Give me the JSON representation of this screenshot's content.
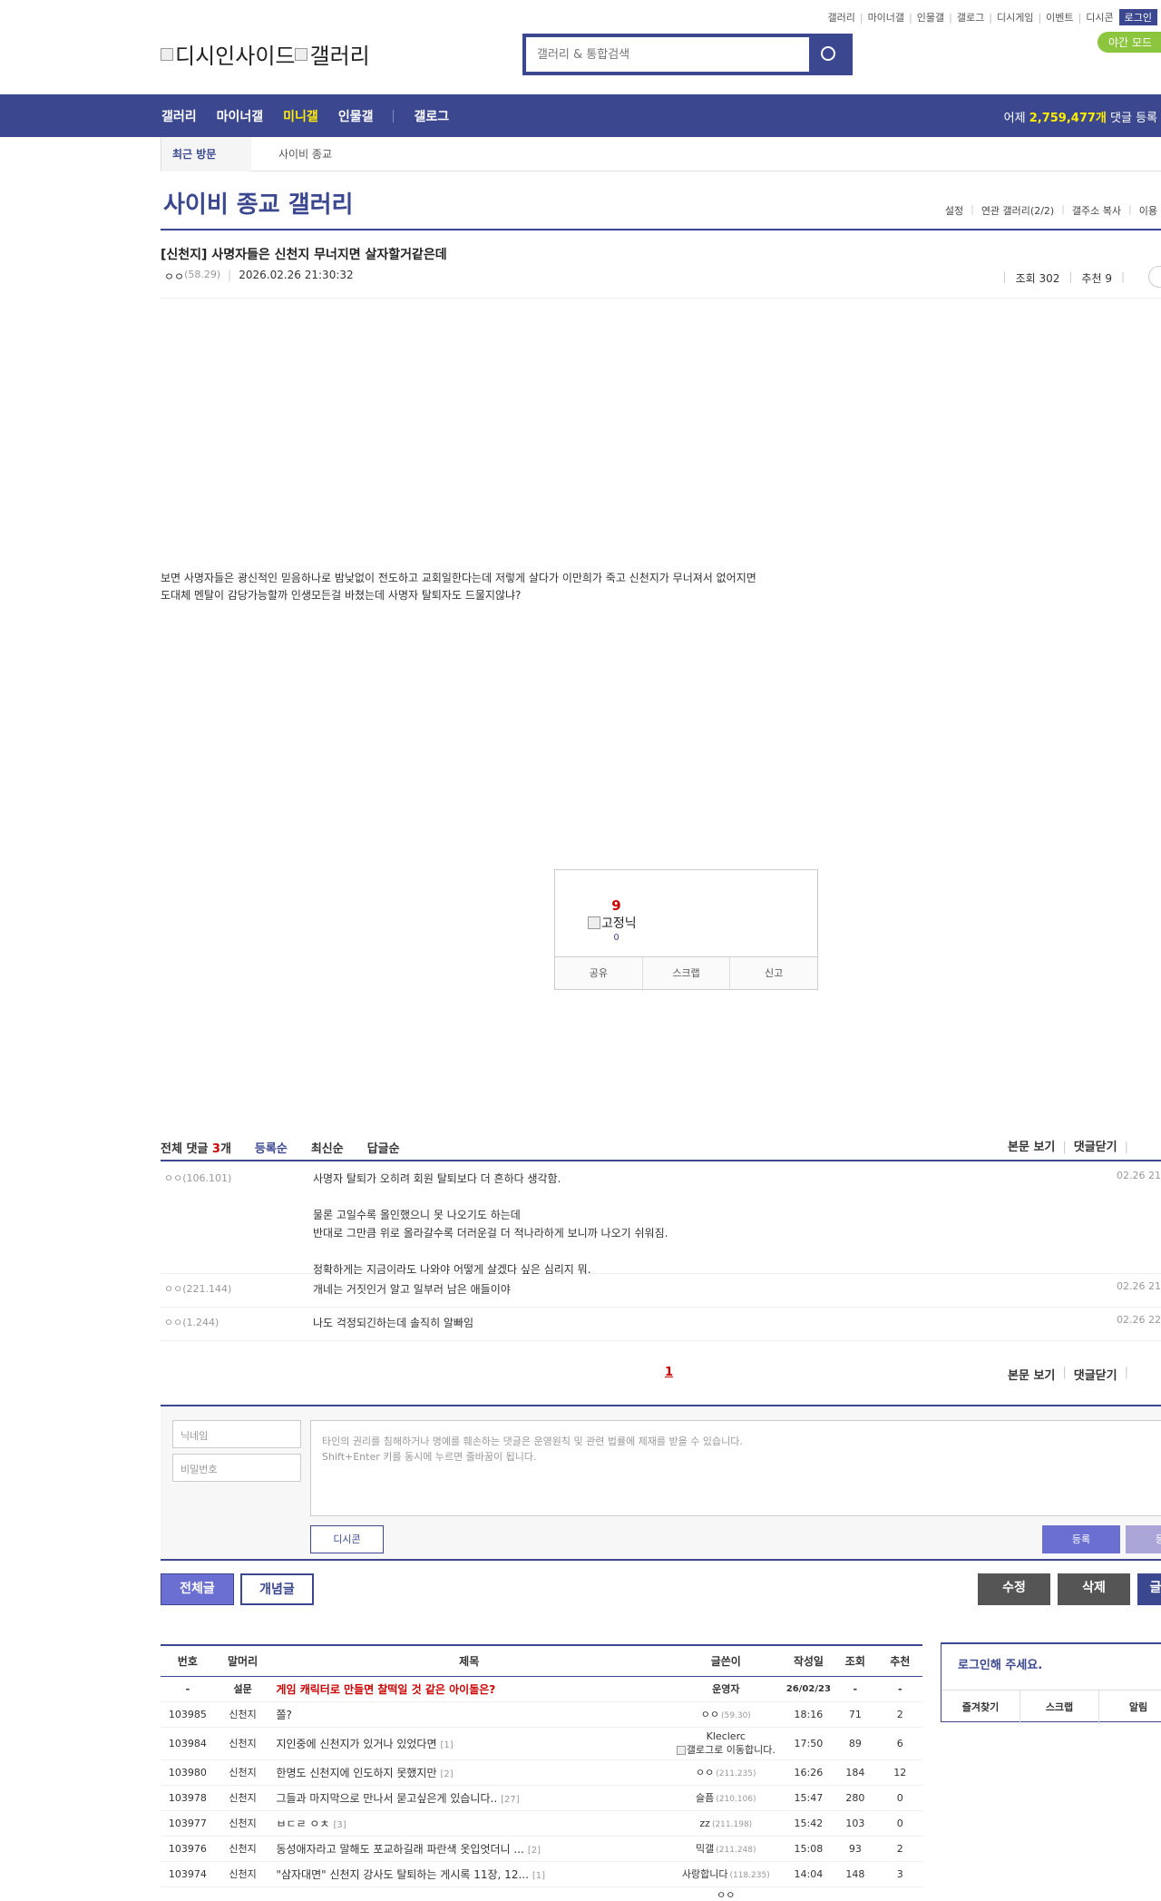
{
  "util": {
    "links": [
      "갤러리",
      "마이너갤",
      "인물갤",
      "갤로그",
      "디시게임",
      "이벤트",
      "디시콘"
    ],
    "login": "로그인",
    "night": "야간 모드"
  },
  "logo": {
    "brand": "디시인사이드",
    "sub": "갤러리"
  },
  "search": {
    "placeholder": "갤러리 & 통합검색"
  },
  "gnb": {
    "items": [
      "갤러리",
      "마이너갤",
      "미니갤",
      "인물갤",
      "갤로그"
    ],
    "stat_prefix": "어제 ",
    "stat_value": "2,759,477개",
    "stat_suffix": " 댓글 등록"
  },
  "recent": {
    "label": "최근 방문",
    "item": "사이비 종교"
  },
  "gallery": {
    "title": "사이비 종교 갤러리",
    "menu": [
      "설정",
      "연관 갤러리(2/2)",
      "갤주소 복사",
      "이용"
    ]
  },
  "post": {
    "title": "[신천지] 사명자들은 신천지 무너지면 살자할거같은데",
    "author": "ㅇㅇ",
    "ip": "(58.29)",
    "date": "2026.02.26 21:30:32",
    "views": "조회 302",
    "recommend": "추천 9",
    "body_line1": "보면 사명자들은 광신적인 믿음하나로 밤낮없이 전도하고 교회일한다는데 저렇게 살다가 이만희가 죽고 신천지가 무너져서 없어지면",
    "body_line2": "도대체 멘탈이 감당가능할까 인생모든걸 바쳤는데 사명자 탈퇴자도 드물지않냐?"
  },
  "recommend_box": {
    "count": "9",
    "fixed_label": "고정닉",
    "fixed_count": "0",
    "share": "공유",
    "scrap": "스크랩",
    "report": "신고"
  },
  "comments": {
    "total_prefix": "전체 댓글 ",
    "total_count": "3",
    "total_suffix": "개",
    "sort": [
      "등록순",
      "최신순",
      "답글순"
    ],
    "view_body": "본문 보기",
    "close": "댓글닫기",
    "items": [
      {
        "who": "ㅇㅇ(106.101)",
        "text": "사명자 탈퇴가 오히려 회원 탈퇴보다 더 흔하다 생각함.\n\n물론 고일수록 올인했으니 못 나오기도 하는데\n반대로 그만큼 위로 올라갈수록 더러운걸 더 적나라하게 보니까 나오기 쉬워짐.\n\n정확하게는 지금이라도 나와야 어떻게 살겠다 싶은 심리지 뭐.",
        "time": "02.26 21"
      },
      {
        "who": "ㅇㅇ(221.144)",
        "text": "개네는 거짓인거 알고 일부러 남은 애들이야",
        "time": "02.26 21"
      },
      {
        "who": "ㅇㅇ(1.244)",
        "text": "나도 걱정되긴하는데 솔직히 알빠임",
        "time": "02.26 22"
      }
    ],
    "page": "1"
  },
  "write": {
    "nick_placeholder": "닉네임",
    "pw_placeholder": "비밀번호",
    "textarea": "타인의 권리를 침해하거나 명예를 훼손하는 댓글은 운영원칙 및 관련 법률에 제재를 받을 수 있습니다.\nShift+Enter 키를 동시에 누르면 줄바꿈이 됩니다.",
    "dccon": "디시콘",
    "submit": "등록",
    "submit2": "등록"
  },
  "buttons": {
    "all": "전체글",
    "concept": "개념글",
    "edit": "수정",
    "delete": "삭제",
    "write": "글"
  },
  "list": {
    "headers": [
      "번호",
      "말머리",
      "제목",
      "글쓴이",
      "작성일",
      "조회",
      "추천"
    ],
    "notice": {
      "num": "-",
      "head": "설문",
      "title": "게임 캐릭터로 만들면 찰떡일 것 같은 아이돌은?",
      "writer": "운영자",
      "date": "26/02/23",
      "views": "-",
      "rec": "-"
    },
    "rows": [
      {
        "num": "103985",
        "head": "신천지",
        "title": "쫄?",
        "rc": "",
        "writer": "ㅇㅇ",
        "ip": "(59.30)",
        "date": "18:16",
        "views": "71",
        "rec": "2"
      },
      {
        "num": "103984",
        "head": "신천지",
        "title": "지인중에 신천지가 있거나 있었다면",
        "rc": "[1]",
        "writer": "Kleclerc",
        "ip": "",
        "gallog": "갤로그로 이동합니다.",
        "date": "17:50",
        "views": "89",
        "rec": "6"
      },
      {
        "num": "103980",
        "head": "신천지",
        "title": "한명도 신천지에 인도하지 못했지만",
        "rc": "[2]",
        "writer": "ㅇㅇ",
        "ip": "(211.235)",
        "date": "16:26",
        "views": "184",
        "rec": "12"
      },
      {
        "num": "103978",
        "head": "신천지",
        "title": "그들과 마지막으로 만나서 묻고싶은게 있습니다..",
        "rc": "[27]",
        "writer": "슬픔",
        "ip": "(210.106)",
        "date": "15:47",
        "views": "280",
        "rec": "0"
      },
      {
        "num": "103977",
        "head": "신천지",
        "title": "ㅂㄷㄹ ㅇㅊ",
        "rc": "[3]",
        "writer": "zz",
        "ip": "(211.198)",
        "date": "15:42",
        "views": "103",
        "rec": "0"
      },
      {
        "num": "103976",
        "head": "신천지",
        "title": "동성애자라고 말해도 포교하길래 파란색 옷입엇더니 ...",
        "rc": "[2]",
        "writer": "믹갤",
        "ip": "(211.248)",
        "date": "15:08",
        "views": "93",
        "rec": "2"
      },
      {
        "num": "103974",
        "head": "신천지",
        "title": "\"삼자대면\" 신천지 강사도 탈퇴하는 게시록 11장, 12...",
        "rc": "[1]",
        "writer": "사랑합니다",
        "ip": "(118.235)",
        "date": "14:04",
        "views": "148",
        "rec": "3"
      }
    ],
    "last_writer_partial": "ㅇㅇ"
  },
  "loginbox": {
    "msg": "로그인해 주세요.",
    "links": [
      "즐겨찾기",
      "스크랩",
      "알림"
    ]
  }
}
